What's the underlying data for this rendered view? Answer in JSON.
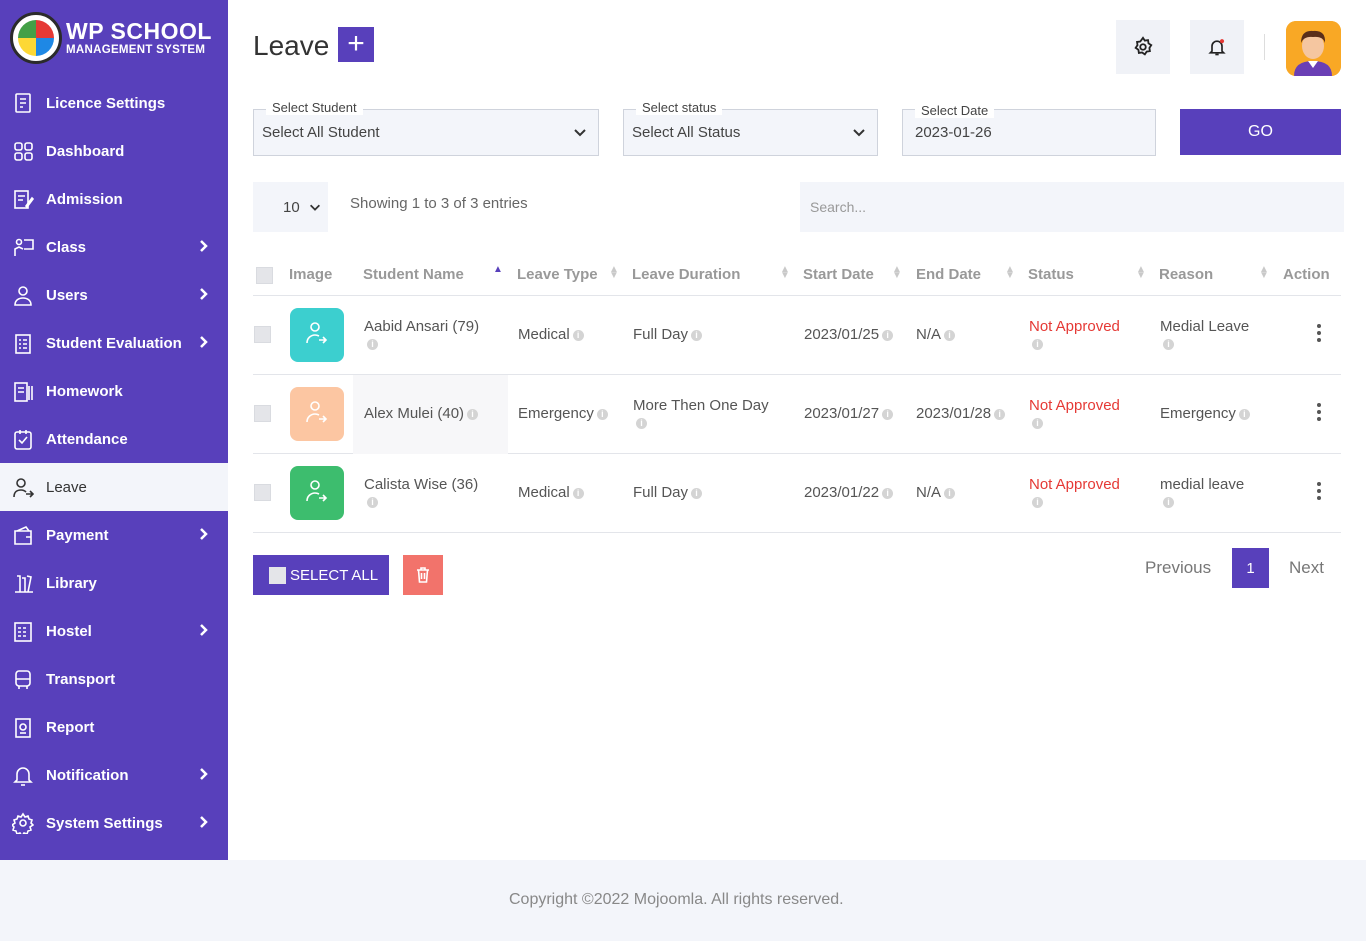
{
  "brand": {
    "title": "WP SCHOOL",
    "subtitle": "MANAGEMENT SYSTEM"
  },
  "sidebar": {
    "items": [
      {
        "label": "Licence Settings",
        "icon": "licence-icon",
        "has_submenu": false
      },
      {
        "label": "Dashboard",
        "icon": "dashboard-icon",
        "has_submenu": false
      },
      {
        "label": "Admission",
        "icon": "admission-icon",
        "has_submenu": false
      },
      {
        "label": "Class",
        "icon": "class-icon",
        "has_submenu": true
      },
      {
        "label": "Users",
        "icon": "user-icon",
        "has_submenu": true
      },
      {
        "label": "Student Evaluation",
        "icon": "evaluation-icon",
        "has_submenu": true
      },
      {
        "label": "Homework",
        "icon": "homework-icon",
        "has_submenu": false
      },
      {
        "label": "Attendance",
        "icon": "attendance-icon",
        "has_submenu": false
      },
      {
        "label": "Leave",
        "icon": "leave-icon",
        "has_submenu": false,
        "active": true
      },
      {
        "label": "Payment",
        "icon": "payment-icon",
        "has_submenu": true
      },
      {
        "label": "Library",
        "icon": "library-icon",
        "has_submenu": false
      },
      {
        "label": "Hostel",
        "icon": "hostel-icon",
        "has_submenu": true
      },
      {
        "label": "Transport",
        "icon": "bus-icon",
        "has_submenu": false
      },
      {
        "label": "Report",
        "icon": "report-icon",
        "has_submenu": false
      },
      {
        "label": "Notification",
        "icon": "bell-icon",
        "has_submenu": true
      },
      {
        "label": "System Settings",
        "icon": "gear-icon",
        "has_submenu": true
      }
    ]
  },
  "header": {
    "title": "Leave",
    "add_label": "+"
  },
  "filters": {
    "student": {
      "label": "Select Student",
      "value": "Select All Student"
    },
    "status": {
      "label": "Select status",
      "value": "Select All Status"
    },
    "date": {
      "label": "Select Date",
      "value": "2023-01-26"
    },
    "go_label": "GO"
  },
  "table_controls": {
    "page_length": "10",
    "info": "Showing 1 to 3 of 3 entries",
    "search_placeholder": "Search..."
  },
  "columns": [
    "Image",
    "Student Name",
    "Leave Type",
    "Leave Duration",
    "Start Date",
    "End Date",
    "Status",
    "Reason",
    "Action"
  ],
  "rows": [
    {
      "name": "Aabid Ansari (79)",
      "leave_type": "Medical",
      "duration": "Full Day",
      "start": "2023/01/25",
      "end": "N/A",
      "status": "Not Approved",
      "reason": "Medial Leave",
      "tile_color": "#3ccfcf"
    },
    {
      "name": "Alex Mulei (40)",
      "leave_type": "Emergency",
      "duration": "More Then One Day",
      "start": "2023/01/27",
      "end": "2023/01/28",
      "status": "Not Approved",
      "reason": "Emergency",
      "tile_color": "#fcc6a2"
    },
    {
      "name": "Calista Wise (36)",
      "leave_type": "Medical",
      "duration": "Full Day",
      "start": "2023/01/22",
      "end": "N/A",
      "status": "Not Approved",
      "reason": "medial leave",
      "tile_color": "#3dbd6e"
    }
  ],
  "bulk": {
    "select_all_label": "SELECT ALL"
  },
  "pagination": {
    "previous": "Previous",
    "current": "1",
    "next": "Next"
  },
  "footer": {
    "text": "Copyright ©2022 Mojoomla. All rights reserved."
  },
  "colors": {
    "primary": "#5840bb",
    "danger": "#e53935",
    "delete": "#f2736b",
    "bg_light": "#f3f5fa"
  }
}
